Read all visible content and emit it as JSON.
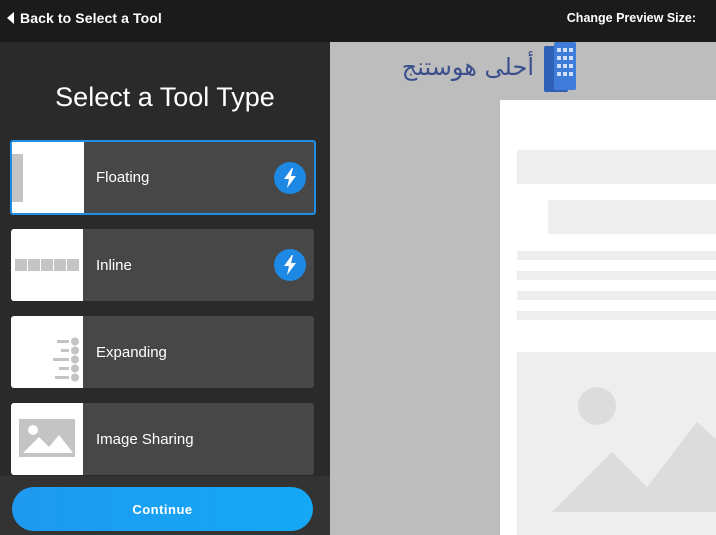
{
  "topbar": {
    "back_label": "Back to Select a Tool",
    "preview_size_label": "Change Preview Size:"
  },
  "sidebar": {
    "title": "Select a Tool Type",
    "tools": [
      {
        "label": "Floating",
        "selected": true,
        "lightning": true
      },
      {
        "label": "Inline",
        "selected": false,
        "lightning": true
      },
      {
        "label": "Expanding",
        "selected": false,
        "lightning": false
      },
      {
        "label": "Image Sharing",
        "selected": false,
        "lightning": false
      }
    ],
    "continue_label": "Continue"
  },
  "watermark": {
    "text": "أحلى هوستنج"
  },
  "colors": {
    "accent": "#1e88e5",
    "selected_border": "#1f8ee8",
    "continue_button": "#1a9ff2",
    "sidebar_bg": "#2a2a2a",
    "tile_bg": "#474747",
    "preview_bg": "#bdbdbd",
    "watermark_text": "#3a4f8c"
  },
  "icons": [
    "back-arrow-icon",
    "lightning-bolt-icon",
    "floating-thumbnail-icon",
    "inline-thumbnail-icon",
    "expanding-thumbnail-icon",
    "image-placeholder-icon",
    "server-icon"
  ]
}
